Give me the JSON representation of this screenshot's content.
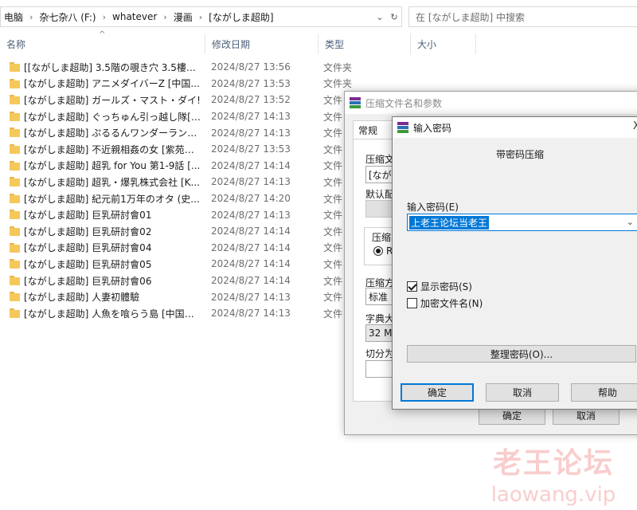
{
  "address_bar": {
    "crumbs": [
      "电脑",
      "杂七杂八 (F:)",
      "whatever",
      "漫画",
      "[ながしま超助]"
    ],
    "dropdown_glyph": "⌄",
    "refresh_glyph": "↻"
  },
  "search": {
    "placeholder": "在 [ながしま超助] 中搜索"
  },
  "columns": {
    "name": "名称",
    "date": "修改日期",
    "type": "类型",
    "size": "大小"
  },
  "files": [
    {
      "name": "[[ながしま超助] 3.5階の覗き穴 3.5樓的...",
      "date": "2024/8/27 13:56",
      "type": "文件夹"
    },
    {
      "name": "[ながしま超助] アニメダイバーZ [中国...",
      "date": "2024/8/27 13:53",
      "type": "文件夹"
    },
    {
      "name": "[ながしま超助] ガールズ・マスト・ダイ!",
      "date": "2024/8/27 13:52",
      "type": "文件"
    },
    {
      "name": "[ながしま超助] ぐっちゅん引っ越し隊[K...",
      "date": "2024/8/27 14:13",
      "type": "文件"
    },
    {
      "name": "[ながしま超助] ぷるるんワンダーランド...",
      "date": "2024/8/27 14:13",
      "type": "文件"
    },
    {
      "name": "[ながしま超助] 不近親相姦の女 [紫苑汉...",
      "date": "2024/8/27 13:53",
      "type": "文件"
    },
    {
      "name": "[ながしま超助] 超乳 for You 第1-9話 [...",
      "date": "2024/8/27 14:14",
      "type": "文件"
    },
    {
      "name": "[ながしま超助] 超乳・爆乳株式会社 [K...",
      "date": "2024/8/27 14:13",
      "type": "文件"
    },
    {
      "name": "[ながしま超助] 紀元前1万年のオタ (史...",
      "date": "2024/8/27 14:20",
      "type": "文件"
    },
    {
      "name": "[ながしま超助] 巨乳研討會01",
      "date": "2024/8/27 14:13",
      "type": "文件"
    },
    {
      "name": "[ながしま超助] 巨乳研討會02",
      "date": "2024/8/27 14:14",
      "type": "文件"
    },
    {
      "name": "[ながしま超助] 巨乳研討會04",
      "date": "2024/8/27 14:14",
      "type": "文件"
    },
    {
      "name": "[ながしま超助] 巨乳研討會05",
      "date": "2024/8/27 14:14",
      "type": "文件"
    },
    {
      "name": "[ながしま超助] 巨乳研討會06",
      "date": "2024/8/27 14:14",
      "type": "文件"
    },
    {
      "name": "[ながしま超助] 人妻初體驗",
      "date": "2024/8/27 14:13",
      "type": "文件"
    },
    {
      "name": "[ながしま超助] 人魚を喰らう島 [中国翻...",
      "date": "2024/8/27 14:13",
      "type": "文件"
    }
  ],
  "archive_dialog": {
    "title": "压缩文件名和参数",
    "tab_general": "常规",
    "label_archive_name": "压缩文",
    "archive_name_value": "[ながし",
    "label_default_profile": "默认配",
    "label_format": "压缩",
    "format_option": "RA",
    "label_method": "压缩方",
    "method_value": "标准",
    "label_dict": "字典大",
    "dict_value": "32 MB",
    "label_split": "切分为",
    "ok_label": "确定",
    "cancel_label": "取消"
  },
  "password_dialog": {
    "title": "输入密码",
    "close_glyph": "X",
    "subtitle": "带密码压缩",
    "label_enter": "输入密码(E)",
    "password_value": "上老王论坛当老王",
    "show_password": "显示密码(S)",
    "show_password_checked": true,
    "encrypt_names": "加密文件名(N)",
    "encrypt_names_checked": false,
    "manage_label": "整理密码(O)...",
    "ok_label": "确定",
    "cancel_label": "取消",
    "help_label": "帮助"
  },
  "watermark": {
    "text": "老王论坛",
    "url": "laowang.vip"
  }
}
